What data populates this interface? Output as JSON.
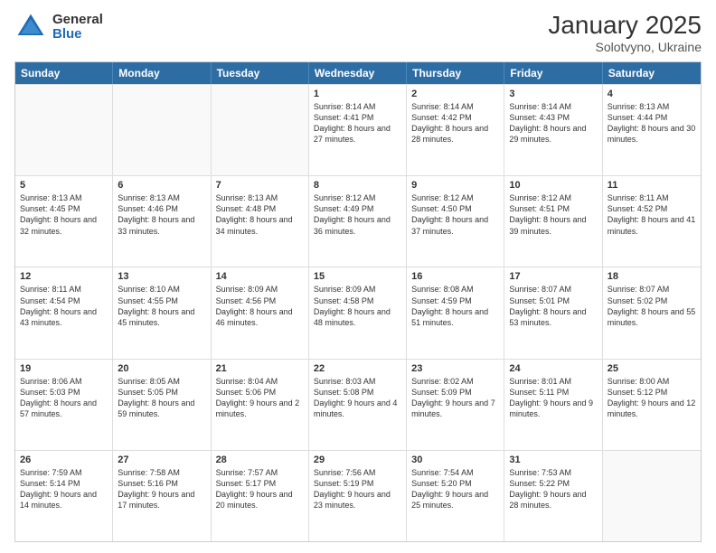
{
  "logo": {
    "general": "General",
    "blue": "Blue"
  },
  "title": "January 2025",
  "subtitle": "Solotvyno, Ukraine",
  "header_days": [
    "Sunday",
    "Monday",
    "Tuesday",
    "Wednesday",
    "Thursday",
    "Friday",
    "Saturday"
  ],
  "rows": [
    [
      {
        "day": "",
        "text": ""
      },
      {
        "day": "",
        "text": ""
      },
      {
        "day": "",
        "text": ""
      },
      {
        "day": "1",
        "text": "Sunrise: 8:14 AM\nSunset: 4:41 PM\nDaylight: 8 hours and 27 minutes."
      },
      {
        "day": "2",
        "text": "Sunrise: 8:14 AM\nSunset: 4:42 PM\nDaylight: 8 hours and 28 minutes."
      },
      {
        "day": "3",
        "text": "Sunrise: 8:14 AM\nSunset: 4:43 PM\nDaylight: 8 hours and 29 minutes."
      },
      {
        "day": "4",
        "text": "Sunrise: 8:13 AM\nSunset: 4:44 PM\nDaylight: 8 hours and 30 minutes."
      }
    ],
    [
      {
        "day": "5",
        "text": "Sunrise: 8:13 AM\nSunset: 4:45 PM\nDaylight: 8 hours and 32 minutes."
      },
      {
        "day": "6",
        "text": "Sunrise: 8:13 AM\nSunset: 4:46 PM\nDaylight: 8 hours and 33 minutes."
      },
      {
        "day": "7",
        "text": "Sunrise: 8:13 AM\nSunset: 4:48 PM\nDaylight: 8 hours and 34 minutes."
      },
      {
        "day": "8",
        "text": "Sunrise: 8:12 AM\nSunset: 4:49 PM\nDaylight: 8 hours and 36 minutes."
      },
      {
        "day": "9",
        "text": "Sunrise: 8:12 AM\nSunset: 4:50 PM\nDaylight: 8 hours and 37 minutes."
      },
      {
        "day": "10",
        "text": "Sunrise: 8:12 AM\nSunset: 4:51 PM\nDaylight: 8 hours and 39 minutes."
      },
      {
        "day": "11",
        "text": "Sunrise: 8:11 AM\nSunset: 4:52 PM\nDaylight: 8 hours and 41 minutes."
      }
    ],
    [
      {
        "day": "12",
        "text": "Sunrise: 8:11 AM\nSunset: 4:54 PM\nDaylight: 8 hours and 43 minutes."
      },
      {
        "day": "13",
        "text": "Sunrise: 8:10 AM\nSunset: 4:55 PM\nDaylight: 8 hours and 45 minutes."
      },
      {
        "day": "14",
        "text": "Sunrise: 8:09 AM\nSunset: 4:56 PM\nDaylight: 8 hours and 46 minutes."
      },
      {
        "day": "15",
        "text": "Sunrise: 8:09 AM\nSunset: 4:58 PM\nDaylight: 8 hours and 48 minutes."
      },
      {
        "day": "16",
        "text": "Sunrise: 8:08 AM\nSunset: 4:59 PM\nDaylight: 8 hours and 51 minutes."
      },
      {
        "day": "17",
        "text": "Sunrise: 8:07 AM\nSunset: 5:01 PM\nDaylight: 8 hours and 53 minutes."
      },
      {
        "day": "18",
        "text": "Sunrise: 8:07 AM\nSunset: 5:02 PM\nDaylight: 8 hours and 55 minutes."
      }
    ],
    [
      {
        "day": "19",
        "text": "Sunrise: 8:06 AM\nSunset: 5:03 PM\nDaylight: 8 hours and 57 minutes."
      },
      {
        "day": "20",
        "text": "Sunrise: 8:05 AM\nSunset: 5:05 PM\nDaylight: 8 hours and 59 minutes."
      },
      {
        "day": "21",
        "text": "Sunrise: 8:04 AM\nSunset: 5:06 PM\nDaylight: 9 hours and 2 minutes."
      },
      {
        "day": "22",
        "text": "Sunrise: 8:03 AM\nSunset: 5:08 PM\nDaylight: 9 hours and 4 minutes."
      },
      {
        "day": "23",
        "text": "Sunrise: 8:02 AM\nSunset: 5:09 PM\nDaylight: 9 hours and 7 minutes."
      },
      {
        "day": "24",
        "text": "Sunrise: 8:01 AM\nSunset: 5:11 PM\nDaylight: 9 hours and 9 minutes."
      },
      {
        "day": "25",
        "text": "Sunrise: 8:00 AM\nSunset: 5:12 PM\nDaylight: 9 hours and 12 minutes."
      }
    ],
    [
      {
        "day": "26",
        "text": "Sunrise: 7:59 AM\nSunset: 5:14 PM\nDaylight: 9 hours and 14 minutes."
      },
      {
        "day": "27",
        "text": "Sunrise: 7:58 AM\nSunset: 5:16 PM\nDaylight: 9 hours and 17 minutes."
      },
      {
        "day": "28",
        "text": "Sunrise: 7:57 AM\nSunset: 5:17 PM\nDaylight: 9 hours and 20 minutes."
      },
      {
        "day": "29",
        "text": "Sunrise: 7:56 AM\nSunset: 5:19 PM\nDaylight: 9 hours and 23 minutes."
      },
      {
        "day": "30",
        "text": "Sunrise: 7:54 AM\nSunset: 5:20 PM\nDaylight: 9 hours and 25 minutes."
      },
      {
        "day": "31",
        "text": "Sunrise: 7:53 AM\nSunset: 5:22 PM\nDaylight: 9 hours and 28 minutes."
      },
      {
        "day": "",
        "text": ""
      }
    ]
  ]
}
